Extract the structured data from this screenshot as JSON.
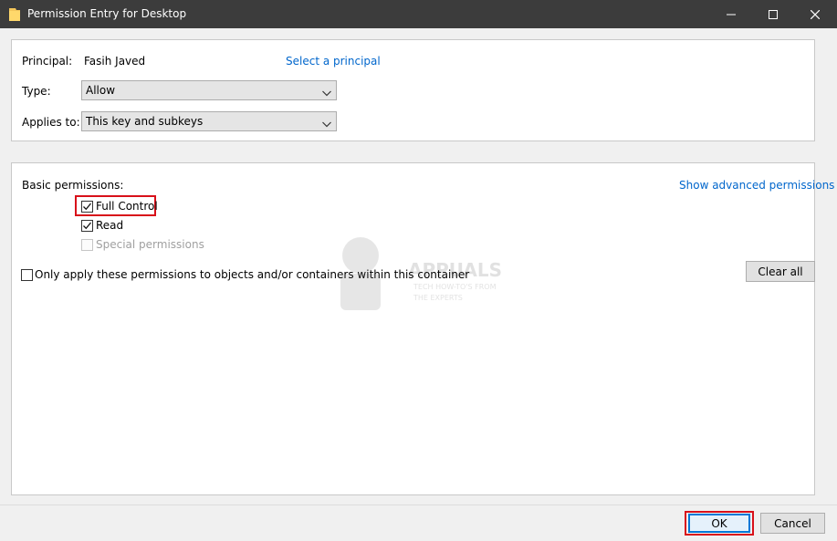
{
  "window": {
    "title": "Permission Entry for Desktop",
    "icon": "folder-icon",
    "controls": [
      "minimize-icon",
      "maximize-icon",
      "close-icon"
    ]
  },
  "principal": {
    "label": "Principal:",
    "value": "Fasih Javed",
    "select_link": "Select a principal"
  },
  "type": {
    "label": "Type:",
    "selected": "Allow"
  },
  "applies_to": {
    "label": "Applies to:",
    "selected": "This key and subkeys"
  },
  "basic_permissions": {
    "heading": "Basic permissions:",
    "advanced_link": "Show advanced permissions",
    "items": [
      {
        "label": "Full Control",
        "checked": true,
        "enabled": true
      },
      {
        "label": "Read",
        "checked": true,
        "enabled": true
      },
      {
        "label": "Special permissions",
        "checked": false,
        "enabled": false
      }
    ]
  },
  "only_apply": {
    "label": "Only apply these permissions to objects and/or containers within this container",
    "checked": false
  },
  "buttons": {
    "clear_all": "Clear all",
    "ok": "OK",
    "cancel": "Cancel"
  },
  "watermark": {
    "brand": "APPUALS",
    "tagline_1": "TECH HOW-TO'S FROM",
    "tagline_2": "THE EXPERTS"
  },
  "colors": {
    "titlebar": "#3c3c3c",
    "link": "#0066cc",
    "highlight": "#d8101a",
    "default_button_border": "#0078d7"
  }
}
